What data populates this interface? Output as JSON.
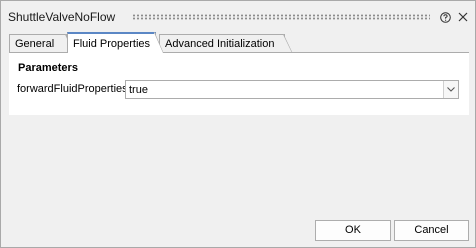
{
  "window": {
    "title": "ShuttleValveNoFlow",
    "help_icon": "help-circle-icon",
    "close_icon": "close-icon"
  },
  "tabs": [
    {
      "label": "General",
      "active": false
    },
    {
      "label": "Fluid Properties",
      "active": true
    },
    {
      "label": "Advanced Initialization",
      "active": false
    }
  ],
  "parameters": {
    "heading": "Parameters",
    "fields": [
      {
        "label": "forwardFluidProperties",
        "value": "true"
      }
    ]
  },
  "buttons": {
    "ok_label": "OK",
    "cancel_label": "Cancel"
  },
  "colors": {
    "background": "#f0f0f0",
    "panel": "#ffffff",
    "active_tab_accent": "#5b87c5",
    "border": "#acacac"
  }
}
